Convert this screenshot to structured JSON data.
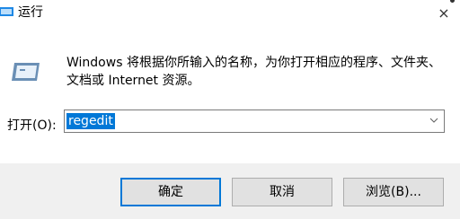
{
  "window": {
    "title": "运行",
    "icon": "run-dialog-icon",
    "close_glyph": "×"
  },
  "dialog": {
    "icon": "run-program-icon",
    "description": "Windows 将根据你所输入的名称，为你打开相应的程序、文件夹、文档或 Internet 资源。"
  },
  "open_field": {
    "label": "打开(O):",
    "value": "regedit"
  },
  "buttons": {
    "ok": "确定",
    "cancel": "取消",
    "browse": "浏览(B)..."
  },
  "colors": {
    "accent": "#0078d7",
    "footer": "#f0f0f0",
    "button": "#e1e1e1"
  }
}
